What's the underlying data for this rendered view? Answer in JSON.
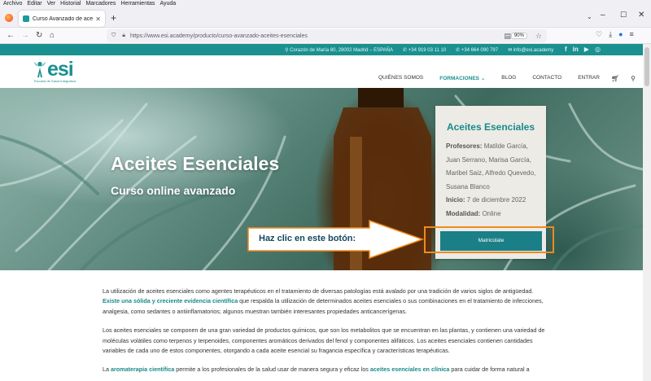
{
  "browser": {
    "menu": [
      "Archivo",
      "Editar",
      "Ver",
      "Historial",
      "Marcadores",
      "Herramientas",
      "Ayuda"
    ],
    "tab_title": "Curso Avanzado de aceites ese",
    "url": "https://www.esi.academy/producto/curso-avanzado-aceites-esenciales",
    "zoom": "90%"
  },
  "topbar": {
    "address": "Corazón de María 80, 28002 Madrid – ESPAÑA",
    "phone1": "+34 919 03 11 10",
    "phone2": "+34 664 090 797",
    "email": "info@esi.academy",
    "social": [
      "f",
      "in",
      "▶",
      "◎"
    ]
  },
  "header": {
    "logo_word": "esi",
    "logo_tagline": "Escuela de Salud Integrativa",
    "menu": {
      "quienes": "QUIÉNES SOMOS",
      "formaciones": "FORMACIONES",
      "blog": "BLOG",
      "contacto": "CONTACTO",
      "entrar": "ENTRAR"
    }
  },
  "hero": {
    "title": "Aceites Esenciales",
    "subtitle": "Curso online avanzado"
  },
  "card": {
    "title": "Aceites Esenciales",
    "profesores_label": "Profesores:",
    "profesores": "Matilde García, Juan Serrano, Marisa García, Maribel Saiz, Alfredo Quevedo, Susana Blanco",
    "inicio_label": "Inicio:",
    "inicio": "7 de diciembre 2022",
    "modalidad_label": "Modalidad:",
    "modalidad": "Online",
    "button": "Matricúlate"
  },
  "callout": "Haz clic en este botón:",
  "content": {
    "p1_a": "La utilización de aceites esenciales como agentes terapéuticos en el tratamiento de diversas patologías está avalado por una tradición de varios siglos de antigüedad. ",
    "p1_hl": "Existe una sólida y creciente evidencia científica",
    "p1_b": " que respalda la utilización de determinados aceites esenciales o sus combinaciones en el tratamiento de infecciones, analgesia, como sedantes o antiinflamatorios; algunos muestran también interesantes propiedades anticancerígenas.",
    "p2": "Los aceites esenciales se componen de una gran variedad de productos químicos, que son los metabolitos que se encuentran en las plantas, y contienen una variedad de moléculas volátiles como terpenos y terpenoides, componentes aromáticos derivados del fenol y componentes alifáticos. Los aceites esenciales contienen cantidades variables de cada uno de estos componentes, otorgando a cada aceite esencial su fragancia específica y características terapéuticas.",
    "p3_a": "La ",
    "p3_hl1": "aromaterapia científica",
    "p3_b": " permite a los profesionales de la salud usar de manera segura y eficaz los ",
    "p3_hl2": "aceites esenciales en clínica",
    "p3_c": " para cuidar de forma natural a"
  }
}
